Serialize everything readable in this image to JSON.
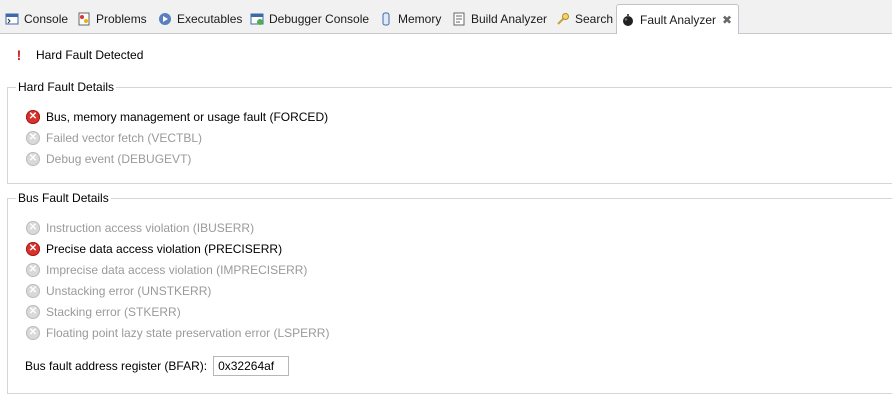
{
  "tabs": [
    {
      "label": "Console",
      "icon": "console-icon"
    },
    {
      "label": "Problems",
      "icon": "problems-icon"
    },
    {
      "label": "Executables",
      "icon": "executables-icon"
    },
    {
      "label": "Debugger Console",
      "icon": "debugger-console-icon"
    },
    {
      "label": "Memory",
      "icon": "memory-icon"
    },
    {
      "label": "Build Analyzer",
      "icon": "build-analyzer-icon"
    },
    {
      "label": "Search",
      "icon": "search-icon"
    },
    {
      "label": "Fault Analyzer",
      "icon": "fault-analyzer-icon",
      "active": true
    }
  ],
  "header": {
    "title": "Hard Fault Detected"
  },
  "hard_fault": {
    "title": "Hard Fault Details",
    "items": [
      {
        "label": "Bus, memory management or usage fault (FORCED)",
        "active": true
      },
      {
        "label": "Failed vector fetch (VECTBL)",
        "active": false
      },
      {
        "label": "Debug event (DEBUGEVT)",
        "active": false
      }
    ]
  },
  "bus_fault": {
    "title": "Bus Fault Details",
    "items": [
      {
        "label": "Instruction access violation (IBUSERR)",
        "active": false
      },
      {
        "label": "Precise data access violation (PRECISERR)",
        "active": true
      },
      {
        "label": "Imprecise data access violation (IMPRECISERR)",
        "active": false
      },
      {
        "label": "Unstacking error (UNSTKERR)",
        "active": false
      },
      {
        "label": "Stacking error (STKERR)",
        "active": false
      },
      {
        "label": "Floating point lazy state preservation error (LSPERR)",
        "active": false
      }
    ],
    "bfar_label": "Bus fault address register (BFAR):",
    "bfar_value": "0x32264af"
  },
  "colors": {
    "error": "#d8322c",
    "disabled": "#9a9a9a"
  }
}
